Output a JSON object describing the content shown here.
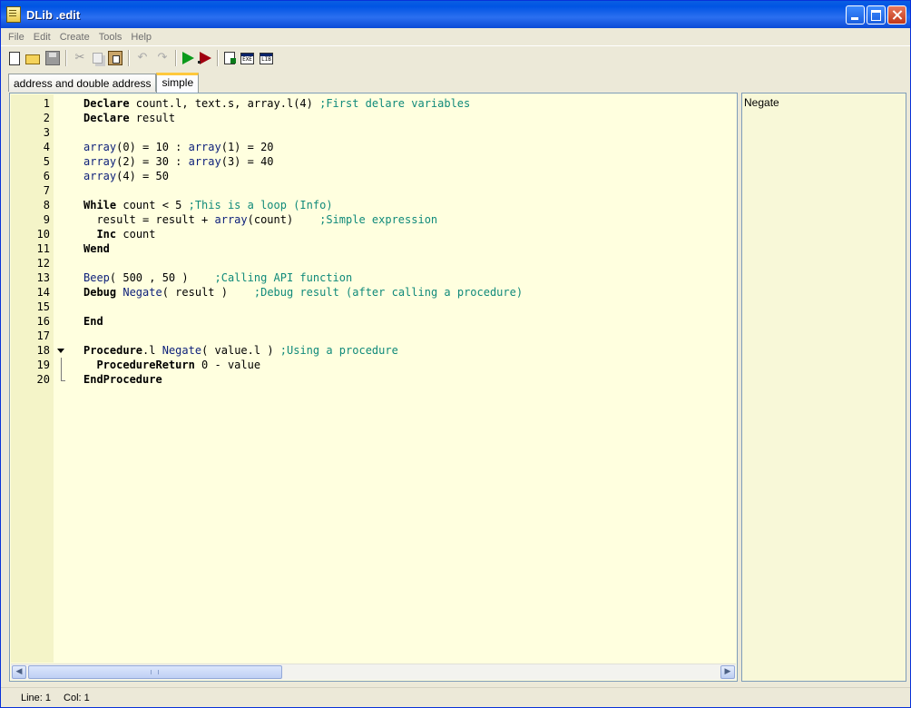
{
  "window": {
    "title": "DLib .edit"
  },
  "menu": [
    "File",
    "Edit",
    "Create",
    "Tools",
    "Help"
  ],
  "toolbar": {
    "icons": [
      "new-file-icon",
      "open-folder-icon",
      "save-icon",
      "cut-icon",
      "copy-icon",
      "paste-icon",
      "undo-icon",
      "redo-icon",
      "run-icon",
      "debug-run-icon",
      "compile-icon",
      "create-exe-icon",
      "create-lib-icon"
    ],
    "exe_label": "EXE",
    "lib_label": "LIB"
  },
  "tabs": [
    {
      "label": "address and double address",
      "active": false
    },
    {
      "label": "simple",
      "active": true
    }
  ],
  "editor": {
    "lines": [
      {
        "n": "1",
        "parts": [
          {
            "t": "Declare",
            "c": "kw"
          },
          {
            "t": " count.l, text.s, array.l(4) ",
            "c": ""
          },
          {
            "t": ";First delare variables",
            "c": "cm"
          }
        ]
      },
      {
        "n": "2",
        "parts": [
          {
            "t": "Declare",
            "c": "kw"
          },
          {
            "t": " result",
            "c": ""
          }
        ]
      },
      {
        "n": "3",
        "parts": []
      },
      {
        "n": "4",
        "parts": [
          {
            "t": "array",
            "c": "fn"
          },
          {
            "t": "(0) = 10 : ",
            "c": ""
          },
          {
            "t": "array",
            "c": "fn"
          },
          {
            "t": "(1) = 20",
            "c": ""
          }
        ]
      },
      {
        "n": "5",
        "parts": [
          {
            "t": "array",
            "c": "fn"
          },
          {
            "t": "(2) = 30 : ",
            "c": ""
          },
          {
            "t": "array",
            "c": "fn"
          },
          {
            "t": "(3) = 40",
            "c": ""
          }
        ]
      },
      {
        "n": "6",
        "parts": [
          {
            "t": "array",
            "c": "fn"
          },
          {
            "t": "(4) = 50",
            "c": ""
          }
        ]
      },
      {
        "n": "7",
        "parts": []
      },
      {
        "n": "8",
        "parts": [
          {
            "t": "While",
            "c": "kw"
          },
          {
            "t": " count < 5 ",
            "c": ""
          },
          {
            "t": ";This is a loop (Info)",
            "c": "cm"
          }
        ]
      },
      {
        "n": "9",
        "parts": [
          {
            "t": "  result = result + ",
            "c": ""
          },
          {
            "t": "array",
            "c": "fn"
          },
          {
            "t": "(count)    ",
            "c": ""
          },
          {
            "t": ";Simple expression",
            "c": "cm"
          }
        ]
      },
      {
        "n": "10",
        "parts": [
          {
            "t": "  ",
            "c": ""
          },
          {
            "t": "Inc",
            "c": "kw"
          },
          {
            "t": " count",
            "c": ""
          }
        ]
      },
      {
        "n": "11",
        "parts": [
          {
            "t": "Wend",
            "c": "kw"
          }
        ]
      },
      {
        "n": "12",
        "parts": []
      },
      {
        "n": "13",
        "parts": [
          {
            "t": "Beep",
            "c": "fn"
          },
          {
            "t": "( 500 , 50 )    ",
            "c": ""
          },
          {
            "t": ";Calling API function",
            "c": "cm"
          }
        ]
      },
      {
        "n": "14",
        "parts": [
          {
            "t": "Debug",
            "c": "kw"
          },
          {
            "t": " ",
            "c": ""
          },
          {
            "t": "Negate",
            "c": "fn"
          },
          {
            "t": "( result )    ",
            "c": ""
          },
          {
            "t": ";Debug result (after calling a procedure)",
            "c": "cm"
          }
        ]
      },
      {
        "n": "15",
        "parts": []
      },
      {
        "n": "16",
        "parts": [
          {
            "t": "End",
            "c": "kw"
          }
        ]
      },
      {
        "n": "17",
        "parts": []
      },
      {
        "n": "18",
        "fold": "arrow",
        "parts": [
          {
            "t": "Procedure",
            "c": "kw"
          },
          {
            "t": ".l ",
            "c": ""
          },
          {
            "t": "Negate",
            "c": "fn"
          },
          {
            "t": "( value.l ) ",
            "c": ""
          },
          {
            "t": ";Using a procedure",
            "c": "cm"
          }
        ]
      },
      {
        "n": "19",
        "fold": "bar",
        "parts": [
          {
            "t": "  ",
            "c": ""
          },
          {
            "t": "ProcedureReturn",
            "c": "kw"
          },
          {
            "t": " 0 - value",
            "c": ""
          }
        ]
      },
      {
        "n": "20",
        "fold": "end",
        "parts": [
          {
            "t": "EndProcedure",
            "c": "kw"
          }
        ]
      }
    ]
  },
  "procedures_panel": {
    "items": [
      "Negate"
    ]
  },
  "status": {
    "line": "Line: 1",
    "col": "Col: 1"
  }
}
